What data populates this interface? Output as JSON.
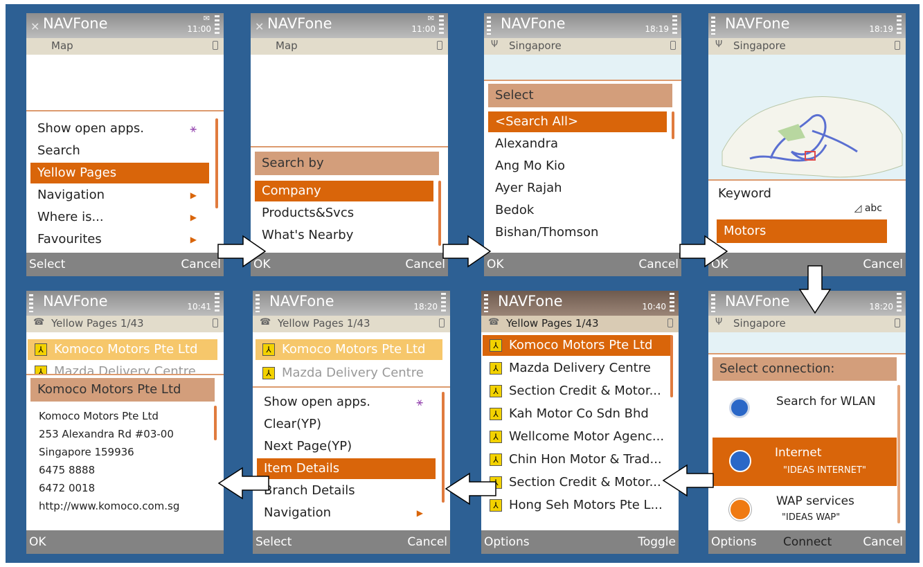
{
  "app_name": "NAVFone",
  "softkeys": {
    "select": "Select",
    "cancel": "Cancel",
    "ok": "OK",
    "options": "Options",
    "toggle": "Toggle",
    "connect": "Connect"
  },
  "screen1": {
    "time": "11:00",
    "subtitle": "Map",
    "menu": [
      "Show open apps.",
      "Search",
      "Yellow Pages",
      "Navigation",
      "Where is...",
      "Favourites"
    ]
  },
  "screen2": {
    "time": "11:00",
    "subtitle": "Map",
    "heading": "Search by",
    "items": [
      "Company",
      "Products&Svcs",
      "What's Nearby"
    ]
  },
  "screen3": {
    "time": "18:19",
    "subtitle": "Singapore",
    "heading": "Select",
    "items": [
      "<Search All>",
      "Alexandra",
      "Ang Mo Kio",
      "Ayer Rajah",
      "Bedok",
      "Bishan/Thomson"
    ]
  },
  "screen4": {
    "time": "18:19",
    "subtitle": "Singapore",
    "keyword_label": "Keyword",
    "input_mode": "abc",
    "keyword_value": "Motors"
  },
  "screen5": {
    "time": "10:41",
    "subtitle": "Yellow Pages 1/43",
    "items": [
      "Komoco Motors Pte Ltd",
      "Mazda Delivery Centre"
    ],
    "popup_title": "Komoco Motors Pte Ltd",
    "details": [
      "Komoco Motors Pte Ltd",
      "253 Alexandra Rd #03-00",
      "Singapore 159936",
      "6475 8888",
      "6472 0018",
      "http://www.komoco.com.sg"
    ]
  },
  "screen6": {
    "time": "18:20",
    "subtitle": "Yellow Pages 1/43",
    "items": [
      "Komoco Motors Pte Ltd",
      "Mazda Delivery Centre"
    ],
    "menu": [
      "Show open apps.",
      "Clear(YP)",
      "Next Page(YP)",
      "Item Details",
      "Branch Details",
      "Navigation"
    ]
  },
  "screen7": {
    "time": "10:40",
    "subtitle": "Yellow Pages 1/43",
    "items": [
      "Komoco Motors Pte Ltd",
      "Mazda Delivery Centre",
      "Section Credit & Motor...",
      "Kah Motor Co Sdn Bhd",
      "Wellcome Motor Agenc...",
      "Chin Hon Motor & Trad...",
      "Section Credit & Motor...",
      "Hong Seh Motors Pte L..."
    ]
  },
  "screen8": {
    "time": "18:20",
    "subtitle": "Singapore",
    "heading": "Select connection:",
    "options": [
      {
        "label": "Search for WLAN",
        "sub": ""
      },
      {
        "label": "Internet",
        "sub": "\"IDEAS INTERNET\""
      },
      {
        "label": "WAP services",
        "sub": "\"IDEAS WAP\""
      }
    ]
  },
  "colors": {
    "background": "#2d6094",
    "accent": "#d9650a",
    "header": "#d39e7b",
    "softbar": "#838383"
  }
}
